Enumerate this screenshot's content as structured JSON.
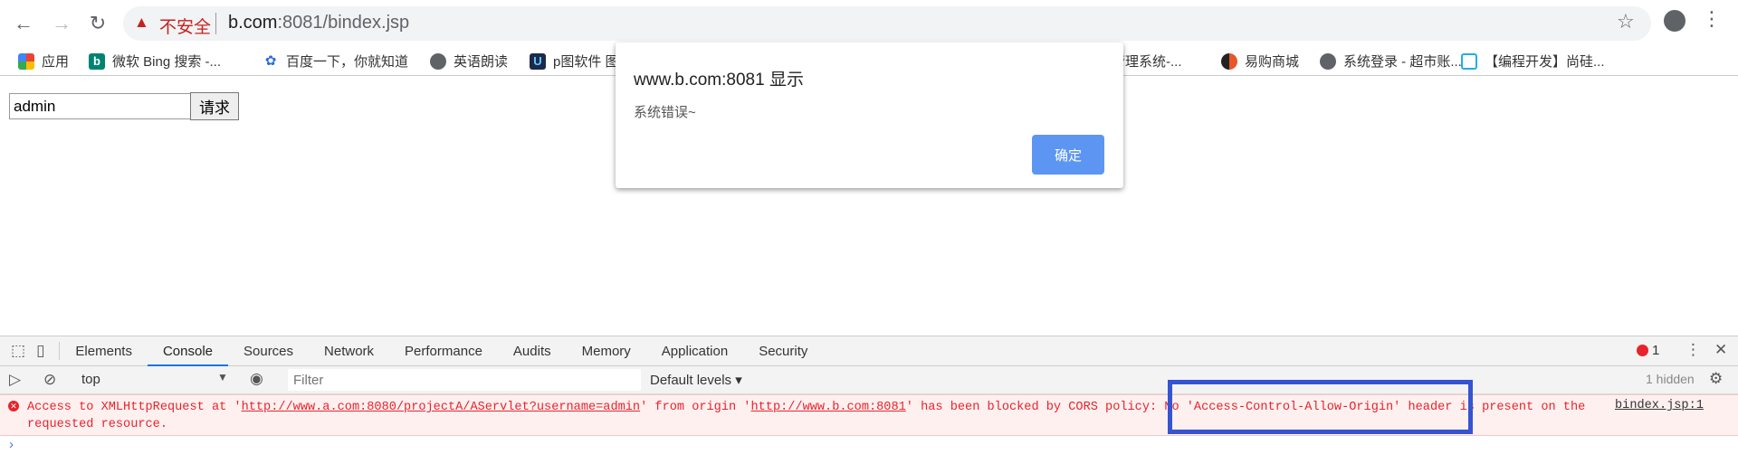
{
  "browser": {
    "security_label": "不安全",
    "url_host": "b.com",
    "url_rest": ":8081/bindex.jsp",
    "bookmarks": [
      {
        "label": "应用",
        "icon": "apps-grid-icon"
      },
      {
        "label": "微软 Bing 搜索 -...",
        "icon": "bing-icon"
      },
      {
        "label": "百度一下，你就知道",
        "icon": "baidu-paw-icon"
      },
      {
        "label": "英语朗读",
        "icon": "globe-icon"
      },
      {
        "label": "p图软件 图",
        "icon": "app-icon"
      },
      {
        "label": "管理系统-...",
        "icon": "none"
      },
      {
        "label": "易购商城",
        "icon": "site-icon"
      },
      {
        "label": "系统登录 - 超市账...",
        "icon": "globe-icon"
      },
      {
        "label": "【编程开发】尚硅...",
        "icon": "bilibili-icon"
      }
    ]
  },
  "page": {
    "input_value": "admin",
    "button_label": "请求"
  },
  "dialog": {
    "title": "www.b.com:8081 显示",
    "message": "系统错误~",
    "ok_label": "确定"
  },
  "devtools": {
    "tabs": [
      "Elements",
      "Console",
      "Sources",
      "Network",
      "Performance",
      "Audits",
      "Memory",
      "Application",
      "Security"
    ],
    "active_tab": "Console",
    "error_count": "1",
    "context": "top",
    "filter_placeholder": "Filter",
    "levels": "Default levels",
    "hidden": "1 hidden",
    "error": {
      "p1": "Access to XMLHttpRequest at '",
      "url1": "http://www.a.com:8080/projectA/AServlet?username=admin",
      "p2": "' from origin '",
      "url2": "http://www.b.com:8081",
      "p3": "' has been blocked by CORS policy: No 'Access-Control-Allow-Origin' header is present on the\nrequested resource.",
      "source": "bindex.jsp:1"
    }
  },
  "colors": {
    "error": "#e8232b",
    "highlight": "#3554d1",
    "accent": "#1a73e8",
    "dialog_button": "#5c96f2"
  }
}
